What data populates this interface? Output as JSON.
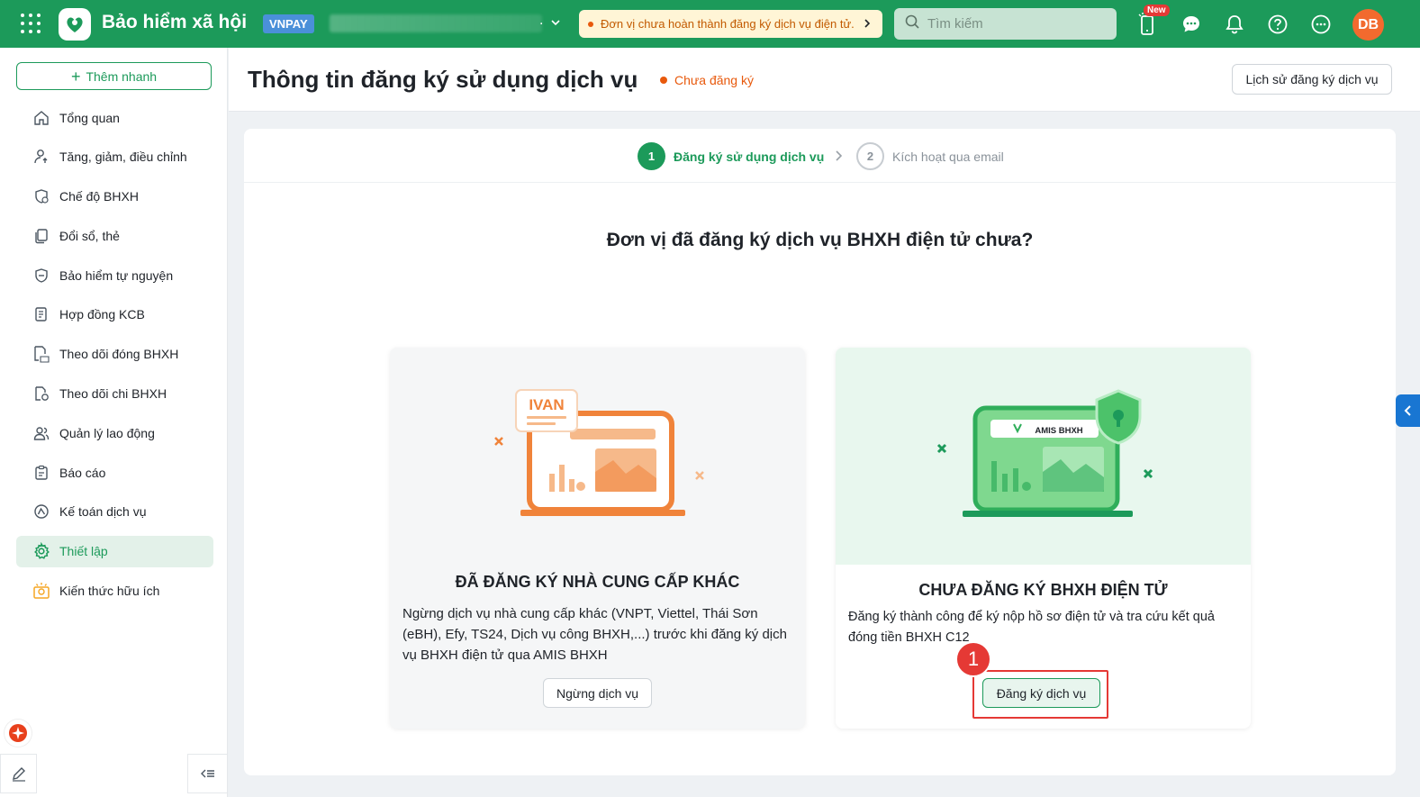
{
  "topbar": {
    "app_name": "Bảo hiểm xã hội",
    "vnpay_badge": "VNPAY",
    "company_suffix": ".",
    "alert_text": "Đơn vị chưa hoàn thành đăng ký dịch vụ điện tử.",
    "search_placeholder": "Tìm kiếm",
    "new_badge": "New",
    "avatar_initials": "DB"
  },
  "sidebar": {
    "quick_add": "Thêm nhanh",
    "items": [
      {
        "label": "Tổng quan",
        "icon": "home-icon"
      },
      {
        "label": "Tăng, giảm, điều chỉnh",
        "icon": "user-arrow-icon"
      },
      {
        "label": "Chế độ BHXH",
        "icon": "shield-heart-icon"
      },
      {
        "label": "Đổi sổ, thẻ",
        "icon": "copy-icon"
      },
      {
        "label": "Bảo hiểm tự nguyện",
        "icon": "shield-icon"
      },
      {
        "label": "Hợp đồng KCB",
        "icon": "contract-icon"
      },
      {
        "label": "Theo dõi đóng BHXH",
        "icon": "c12-doc-icon"
      },
      {
        "label": "Theo dõi chi BHXH",
        "icon": "doc-money-icon"
      },
      {
        "label": "Quản lý lao động",
        "icon": "users-icon"
      },
      {
        "label": "Báo cáo",
        "icon": "clipboard-icon"
      },
      {
        "label": "Kế toán dịch vụ",
        "icon": "accounting-icon"
      },
      {
        "label": "Thiết lập",
        "icon": "gear-icon"
      },
      {
        "label": "Kiến thức hữu ích",
        "icon": "knowledge-icon"
      }
    ]
  },
  "header": {
    "title": "Thông tin đăng ký sử dụng dịch vụ",
    "status": "Chưa đăng ký",
    "history_button": "Lịch sử đăng ký dịch vụ"
  },
  "steps": [
    {
      "num": "1",
      "label": "Đăng ký sử dụng dịch vụ"
    },
    {
      "num": "2",
      "label": "Kích hoạt qua email"
    }
  ],
  "question": "Đơn vị đã đăng ký dịch vụ BHXH điện tử chưa?",
  "options": {
    "left": {
      "ill_label": "IVAN",
      "title": "ĐÃ ĐĂNG KÝ NHÀ CUNG CẤP KHÁC",
      "desc": "Ngừng dịch vụ nhà cung cấp khác (VNPT, Viettel, Thái Sơn (eBH), Efy, TS24, Dịch vụ công BHXH,...) trước khi đăng ký dịch vụ BHXH điện tử qua AMIS BHXH",
      "button": "Ngừng dịch vụ"
    },
    "right": {
      "ill_label": "AMIS BHXH",
      "title": "CHƯA ĐĂNG KÝ BHXH ĐIỆN TỬ",
      "desc": "Đăng ký thành công để ký nộp hồ sơ điện tử và tra cứu kết quả đóng tiền BHXH C12",
      "button": "Đăng ký dịch vụ"
    }
  },
  "annotation": {
    "marker": "1"
  },
  "colors": {
    "primary": "#1c9a5a",
    "warning": "#e8590c",
    "highlight": "#e53935"
  }
}
